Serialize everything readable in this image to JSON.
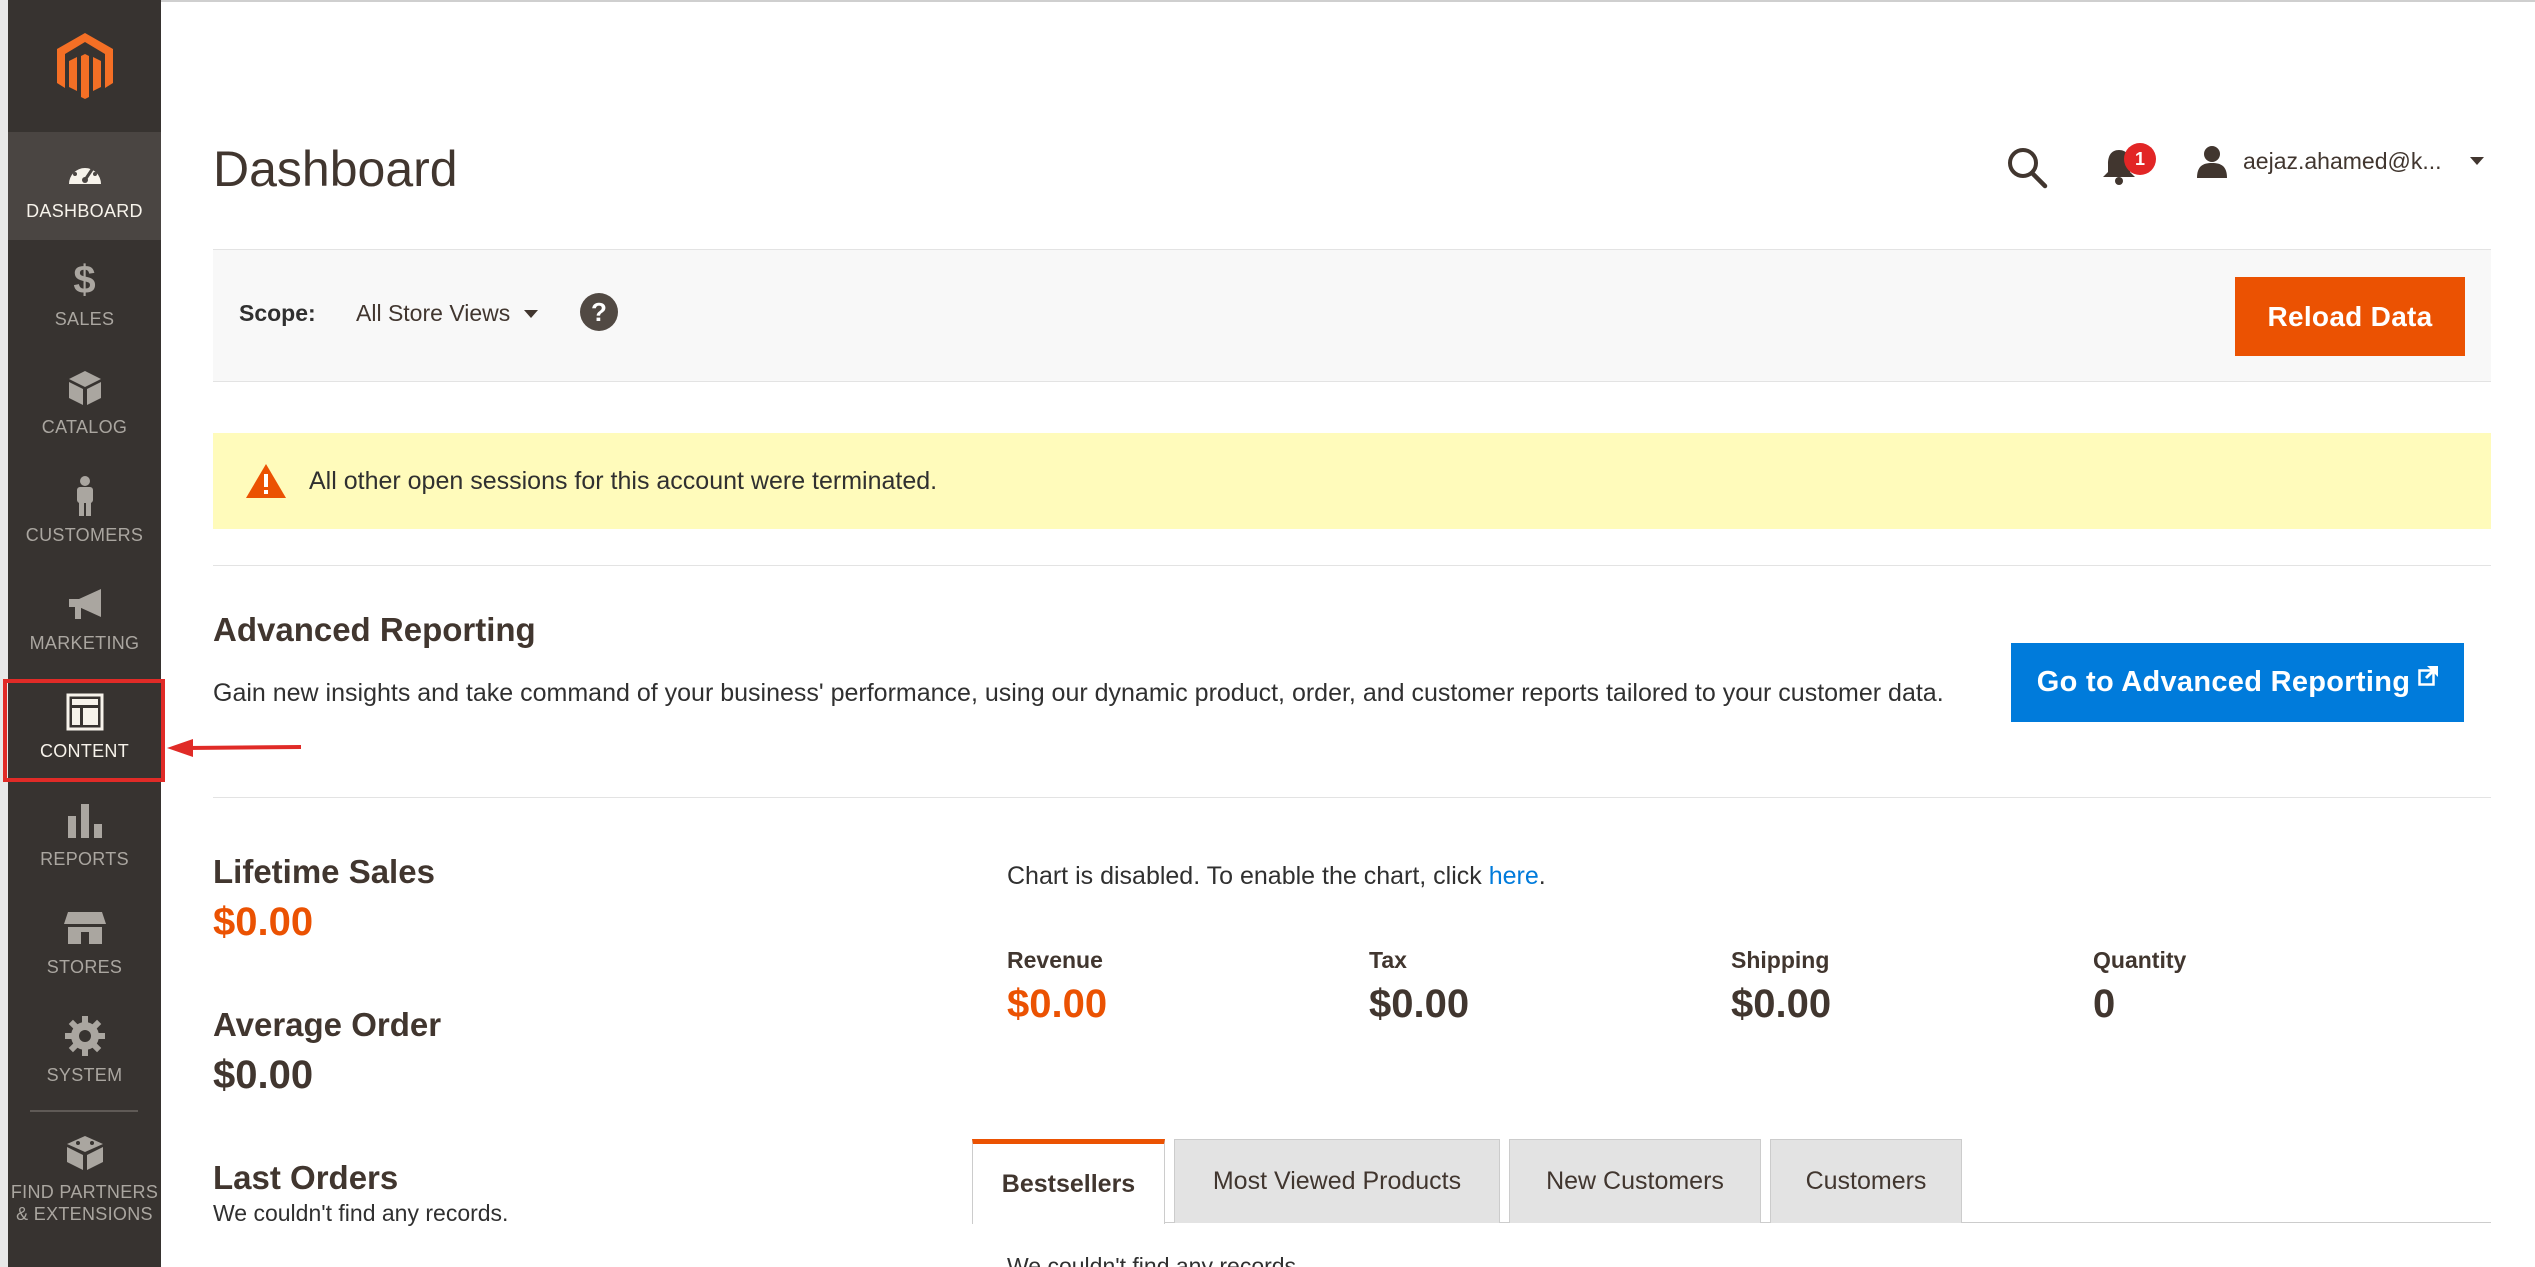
{
  "sidebar": {
    "items": [
      {
        "label": "DASHBOARD",
        "icon": "dashboard-icon",
        "active": true
      },
      {
        "label": "SALES",
        "icon": "dollar-icon"
      },
      {
        "label": "CATALOG",
        "icon": "box-icon"
      },
      {
        "label": "CUSTOMERS",
        "icon": "person-icon"
      },
      {
        "label": "MARKETING",
        "icon": "megaphone-icon"
      },
      {
        "label": "CONTENT",
        "icon": "layout-icon"
      },
      {
        "label": "REPORTS",
        "icon": "bar-chart-icon"
      },
      {
        "label": "STORES",
        "icon": "storefront-icon"
      },
      {
        "label": "SYSTEM",
        "icon": "gear-icon"
      },
      {
        "label": "FIND PARTNERS & EXTENSIONS",
        "icon": "blocks-icon"
      }
    ]
  },
  "header": {
    "title": "Dashboard",
    "notifications_count": "1",
    "user": "aejaz.ahamed@k..."
  },
  "scope": {
    "label": "Scope:",
    "selected": "All Store Views",
    "help": "?",
    "reload_label": "Reload Data"
  },
  "message": {
    "text": "All other open sessions for this account were terminated."
  },
  "advanced_reporting": {
    "title": "Advanced Reporting",
    "description": "Gain new insights and take command of your business' performance, using our dynamic product, order, and customer reports tailored to your customer data.",
    "button_label": "Go to Advanced Reporting"
  },
  "stats": {
    "lifetime_sales_label": "Lifetime Sales",
    "lifetime_sales_value": "$0.00",
    "average_order_label": "Average Order",
    "average_order_value": "$0.00",
    "last_orders_label": "Last Orders",
    "last_orders_empty": "We couldn't find any records."
  },
  "chart": {
    "disabled_text": "Chart is disabled. To enable the chart, click ",
    "link_text": "here",
    "suffix": "."
  },
  "totals": [
    {
      "label": "Revenue",
      "value": "$0.00"
    },
    {
      "label": "Tax",
      "value": "$0.00"
    },
    {
      "label": "Shipping",
      "value": "$0.00"
    },
    {
      "label": "Quantity",
      "value": "0"
    }
  ],
  "tabs": [
    {
      "label": "Bestsellers",
      "active": true
    },
    {
      "label": "Most Viewed Products"
    },
    {
      "label": "New Customers"
    },
    {
      "label": "Customers"
    }
  ],
  "tab_content": {
    "empty": "We couldn't find any records."
  },
  "colors": {
    "sidebar_bg": "#373330",
    "accent_orange": "#eb5202",
    "link_blue": "#007bdb",
    "highlight_red": "#e02b27"
  }
}
